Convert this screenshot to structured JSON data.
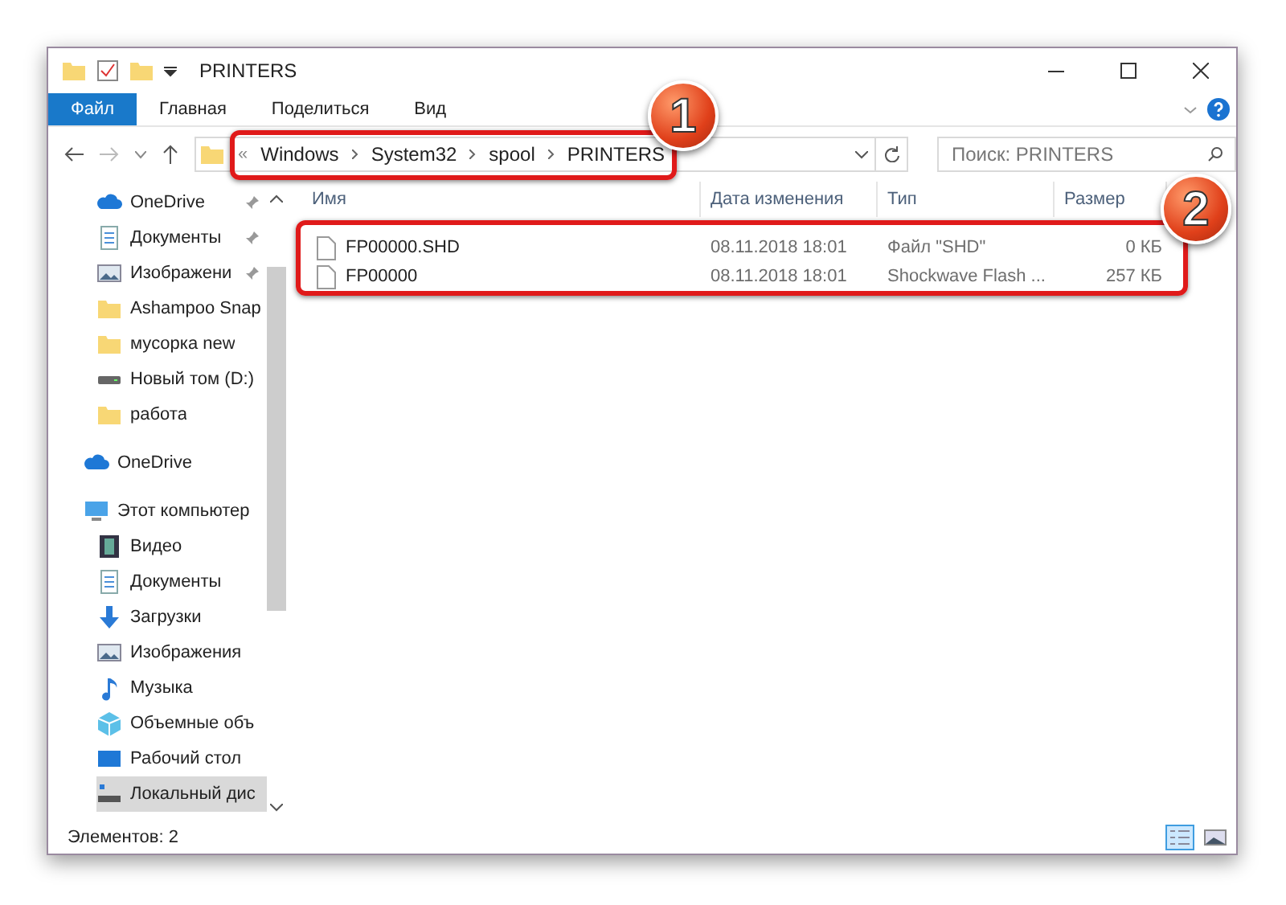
{
  "window": {
    "title": "PRINTERS"
  },
  "ribbon_tabs": [
    {
      "label": "Файл",
      "kind": "file",
      "selected": false
    },
    {
      "label": "Главная",
      "kind": "tab",
      "selected": false
    },
    {
      "label": "Поделиться",
      "kind": "tab",
      "selected": false
    },
    {
      "label": "Вид",
      "kind": "tab",
      "selected": false
    }
  ],
  "address": {
    "overflow": "«",
    "segments": [
      "Windows",
      "System32",
      "spool",
      "PRINTERS"
    ]
  },
  "search": {
    "placeholder": "Поиск: PRINTERS"
  },
  "sidebar": {
    "items": [
      {
        "label": "OneDrive",
        "kind": "cloud",
        "pinned": true,
        "selected": false
      },
      {
        "label": "Документы",
        "kind": "doc",
        "pinned": true,
        "selected": false
      },
      {
        "label": "Изображени",
        "kind": "image",
        "pinned": true,
        "selected": false
      },
      {
        "label": "Ashampoo Snap",
        "kind": "folder",
        "pinned": false,
        "selected": false
      },
      {
        "label": "мусорка new",
        "kind": "folder",
        "pinned": false,
        "selected": false
      },
      {
        "label": "Новый том (D:)",
        "kind": "drive",
        "pinned": false,
        "selected": false
      },
      {
        "label": "работа",
        "kind": "folder",
        "pinned": false,
        "selected": false
      },
      {
        "label": "OneDrive",
        "kind": "cloud",
        "pinned": false,
        "selected": false
      },
      {
        "label": "Этот компьютер",
        "kind": "pc",
        "pinned": false,
        "selected": false,
        "children": [
          {
            "label": "Видео",
            "kind": "video",
            "pinned": false,
            "selected": false
          },
          {
            "label": "Документы",
            "kind": "doc",
            "pinned": false,
            "selected": false
          },
          {
            "label": "Загрузки",
            "kind": "download",
            "pinned": false,
            "selected": false
          },
          {
            "label": "Изображения",
            "kind": "image",
            "pinned": false,
            "selected": false
          },
          {
            "label": "Музыка",
            "kind": "music",
            "pinned": false,
            "selected": false
          },
          {
            "label": "Объемные объ",
            "kind": "cube",
            "pinned": false,
            "selected": false
          },
          {
            "label": "Рабочий стол",
            "kind": "desktop",
            "pinned": false,
            "selected": false
          },
          {
            "label": "Локальный дис",
            "kind": "localdisk",
            "pinned": false,
            "selected": true
          }
        ]
      }
    ]
  },
  "table": {
    "columns": [
      "Имя",
      "Дата изменения",
      "Тип",
      "Размер"
    ],
    "rows": [
      {
        "name": "FP00000.SHD",
        "date": "08.11.2018 18:01",
        "type": "Файл \"SHD\"",
        "size": "0 КБ"
      },
      {
        "name": "FP00000",
        "date": "08.11.2018 18:01",
        "type": "Shockwave Flash ...",
        "size": "257 КБ"
      }
    ]
  },
  "status_bar": {
    "count": "Элементов: 2",
    "view_buttons": [
      {
        "kind": "details",
        "selected": true
      },
      {
        "kind": "tiles",
        "selected": false
      }
    ]
  },
  "callouts": [
    {
      "number": "1"
    },
    {
      "number": "2"
    }
  ]
}
